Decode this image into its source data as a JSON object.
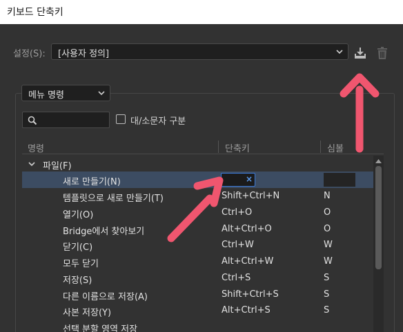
{
  "window": {
    "title": "키보드 단축키"
  },
  "preset": {
    "label": "설정(S):",
    "value": "[사용자 정의]"
  },
  "toolbar": {
    "download_icon": "download-icon",
    "delete_icon": "trash-icon"
  },
  "filter": {
    "menu_value": "메뉴 명령",
    "case_label": "대/소문자 구분",
    "case_checked": false
  },
  "table": {
    "headers": {
      "command": "명령",
      "shortcut": "단축키",
      "symbol": "심볼"
    },
    "group": {
      "label": "파일(F)",
      "expanded": true
    },
    "rows": [
      {
        "name": "새로 만들기(N)",
        "shortcut": "",
        "symbol": "",
        "selected": true,
        "editing": true
      },
      {
        "name": "템플릿으로 새로 만들기(T)",
        "shortcut": "Shift+Ctrl+N",
        "symbol": "N"
      },
      {
        "name": "열기(O)",
        "shortcut": "Ctrl+O",
        "symbol": "O"
      },
      {
        "name": "Bridge에서 찾아보기",
        "shortcut": "Alt+Ctrl+O",
        "symbol": "O"
      },
      {
        "name": "닫기(C)",
        "shortcut": "Ctrl+W",
        "symbol": "W"
      },
      {
        "name": "모두 닫기",
        "shortcut": "Alt+Ctrl+W",
        "symbol": "W"
      },
      {
        "name": "저장(S)",
        "shortcut": "Ctrl+S",
        "symbol": "S"
      },
      {
        "name": "다른 이름으로 저장(A)",
        "shortcut": "Shift+Ctrl+S",
        "symbol": "S"
      },
      {
        "name": "사본 저장(Y)",
        "shortcut": "Alt+Ctrl+S",
        "symbol": "S"
      },
      {
        "name": "선택 분할 영역 저장",
        "shortcut": "",
        "symbol": ""
      }
    ]
  },
  "colors": {
    "accent_arrow": "#f0566f",
    "selected_row": "#3c4c62",
    "focus_border": "#3d7bd9"
  }
}
